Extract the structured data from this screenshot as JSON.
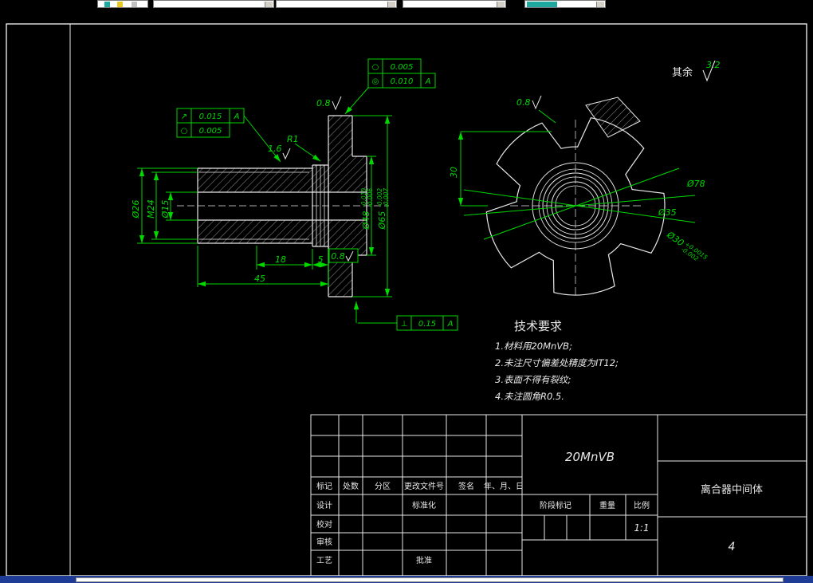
{
  "colors": {
    "dim_green": "#00d800",
    "line_white": "#e8e8e8",
    "background": "#000000"
  },
  "general": {
    "qiyu": "其余",
    "roughness": "3.2"
  },
  "left_view": {
    "d26": "Ø26",
    "m24": "M24",
    "d15": "Ø15",
    "d48": "Ø48",
    "d48_up": "-0.010",
    "d48_low": "-0.006",
    "d65": "Ø65",
    "d65_up": "-0.002",
    "d65_low": "-0.007",
    "len18": "18",
    "len5": "5",
    "len45": "45",
    "r1": "R1",
    "ra16": "1.6",
    "ra08_top": "0.8",
    "ra08_groove": "0.8",
    "fcf1_sym": "↗",
    "fcf1_val": "0.015",
    "fcf1_ref": "A",
    "fcf2_sym": "○",
    "fcf2_val": "0.005",
    "fcf3_sym": "○",
    "fcf3_val": "0.005",
    "fcf4_sym": "◎",
    "fcf4_val": "0.010",
    "fcf4_ref": "A",
    "fcf5_sym": "⊥",
    "fcf5_val": "0.15",
    "fcf5_ref": "A"
  },
  "right_view": {
    "ra08": "0.8",
    "dim30": "30",
    "d78": "Ø78",
    "d35": "Ø35",
    "d30": "Ø30",
    "d30_up": "+0.0015",
    "d30_low": "-0.002"
  },
  "tech": {
    "title": "技术要求",
    "line1": "1.材料用20MnVB;",
    "line2": "2.未注尺寸偏差处精度为IT12;",
    "line3": "3.表面不得有裂纹;",
    "line4": "4.未注圆角R0.5."
  },
  "titleblock": {
    "material": "20MnVB",
    "h_biaoji": "标记",
    "h_chushu": "处数",
    "h_fenqu": "分区",
    "h_genggai": "更改文件号",
    "h_qianming": "签名",
    "h_date": "年、月、日",
    "r_sheji": "设计",
    "r_jiaodui": "校对",
    "r_shenhe": "审核",
    "r_gongyi": "工艺",
    "r_biaozhunhua": "标准化",
    "r_pizhun": "批准",
    "h_jieduan": "阶段标记",
    "h_zhongliang": "重量",
    "h_bili": "比例",
    "scale": "1:1",
    "part_name": "离合器中间体",
    "sheet": "4"
  }
}
